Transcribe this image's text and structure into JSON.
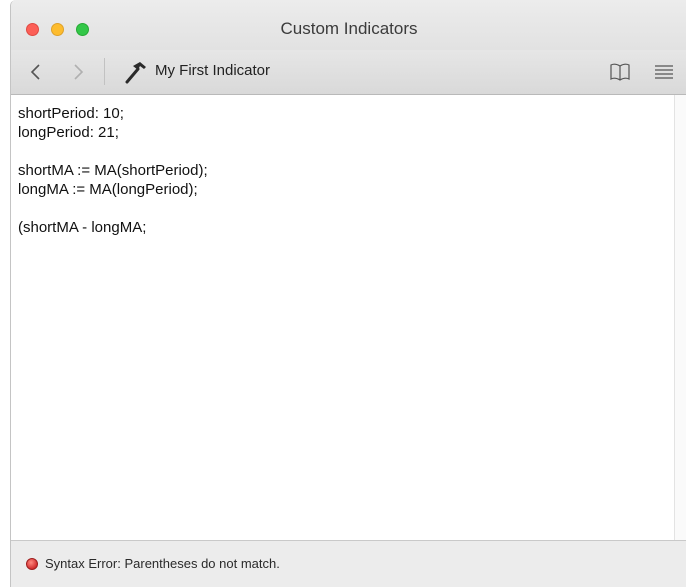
{
  "window": {
    "title": "Custom Indicators"
  },
  "toolbar": {
    "back_glyph": "‹",
    "forward_glyph": "›",
    "document_name": "My First Indicator",
    "icons": [
      "chevron-left-icon",
      "chevron-right-icon",
      "hammer-icon",
      "book-icon",
      "list-icon"
    ]
  },
  "editor": {
    "lines": [
      "shortPeriod: 10;",
      "longPeriod: 21;",
      "",
      "shortMA := MA(shortPeriod);",
      "longMA := MA(longPeriod);",
      "",
      "(shortMA - longMA;"
    ]
  },
  "status": {
    "message": "Syntax Error: Parentheses do not match.",
    "level": "error",
    "color": "#d32f2f"
  },
  "colors": {
    "close": "#fc5f57",
    "minimize": "#fdbc2e",
    "maximize": "#33c748"
  }
}
